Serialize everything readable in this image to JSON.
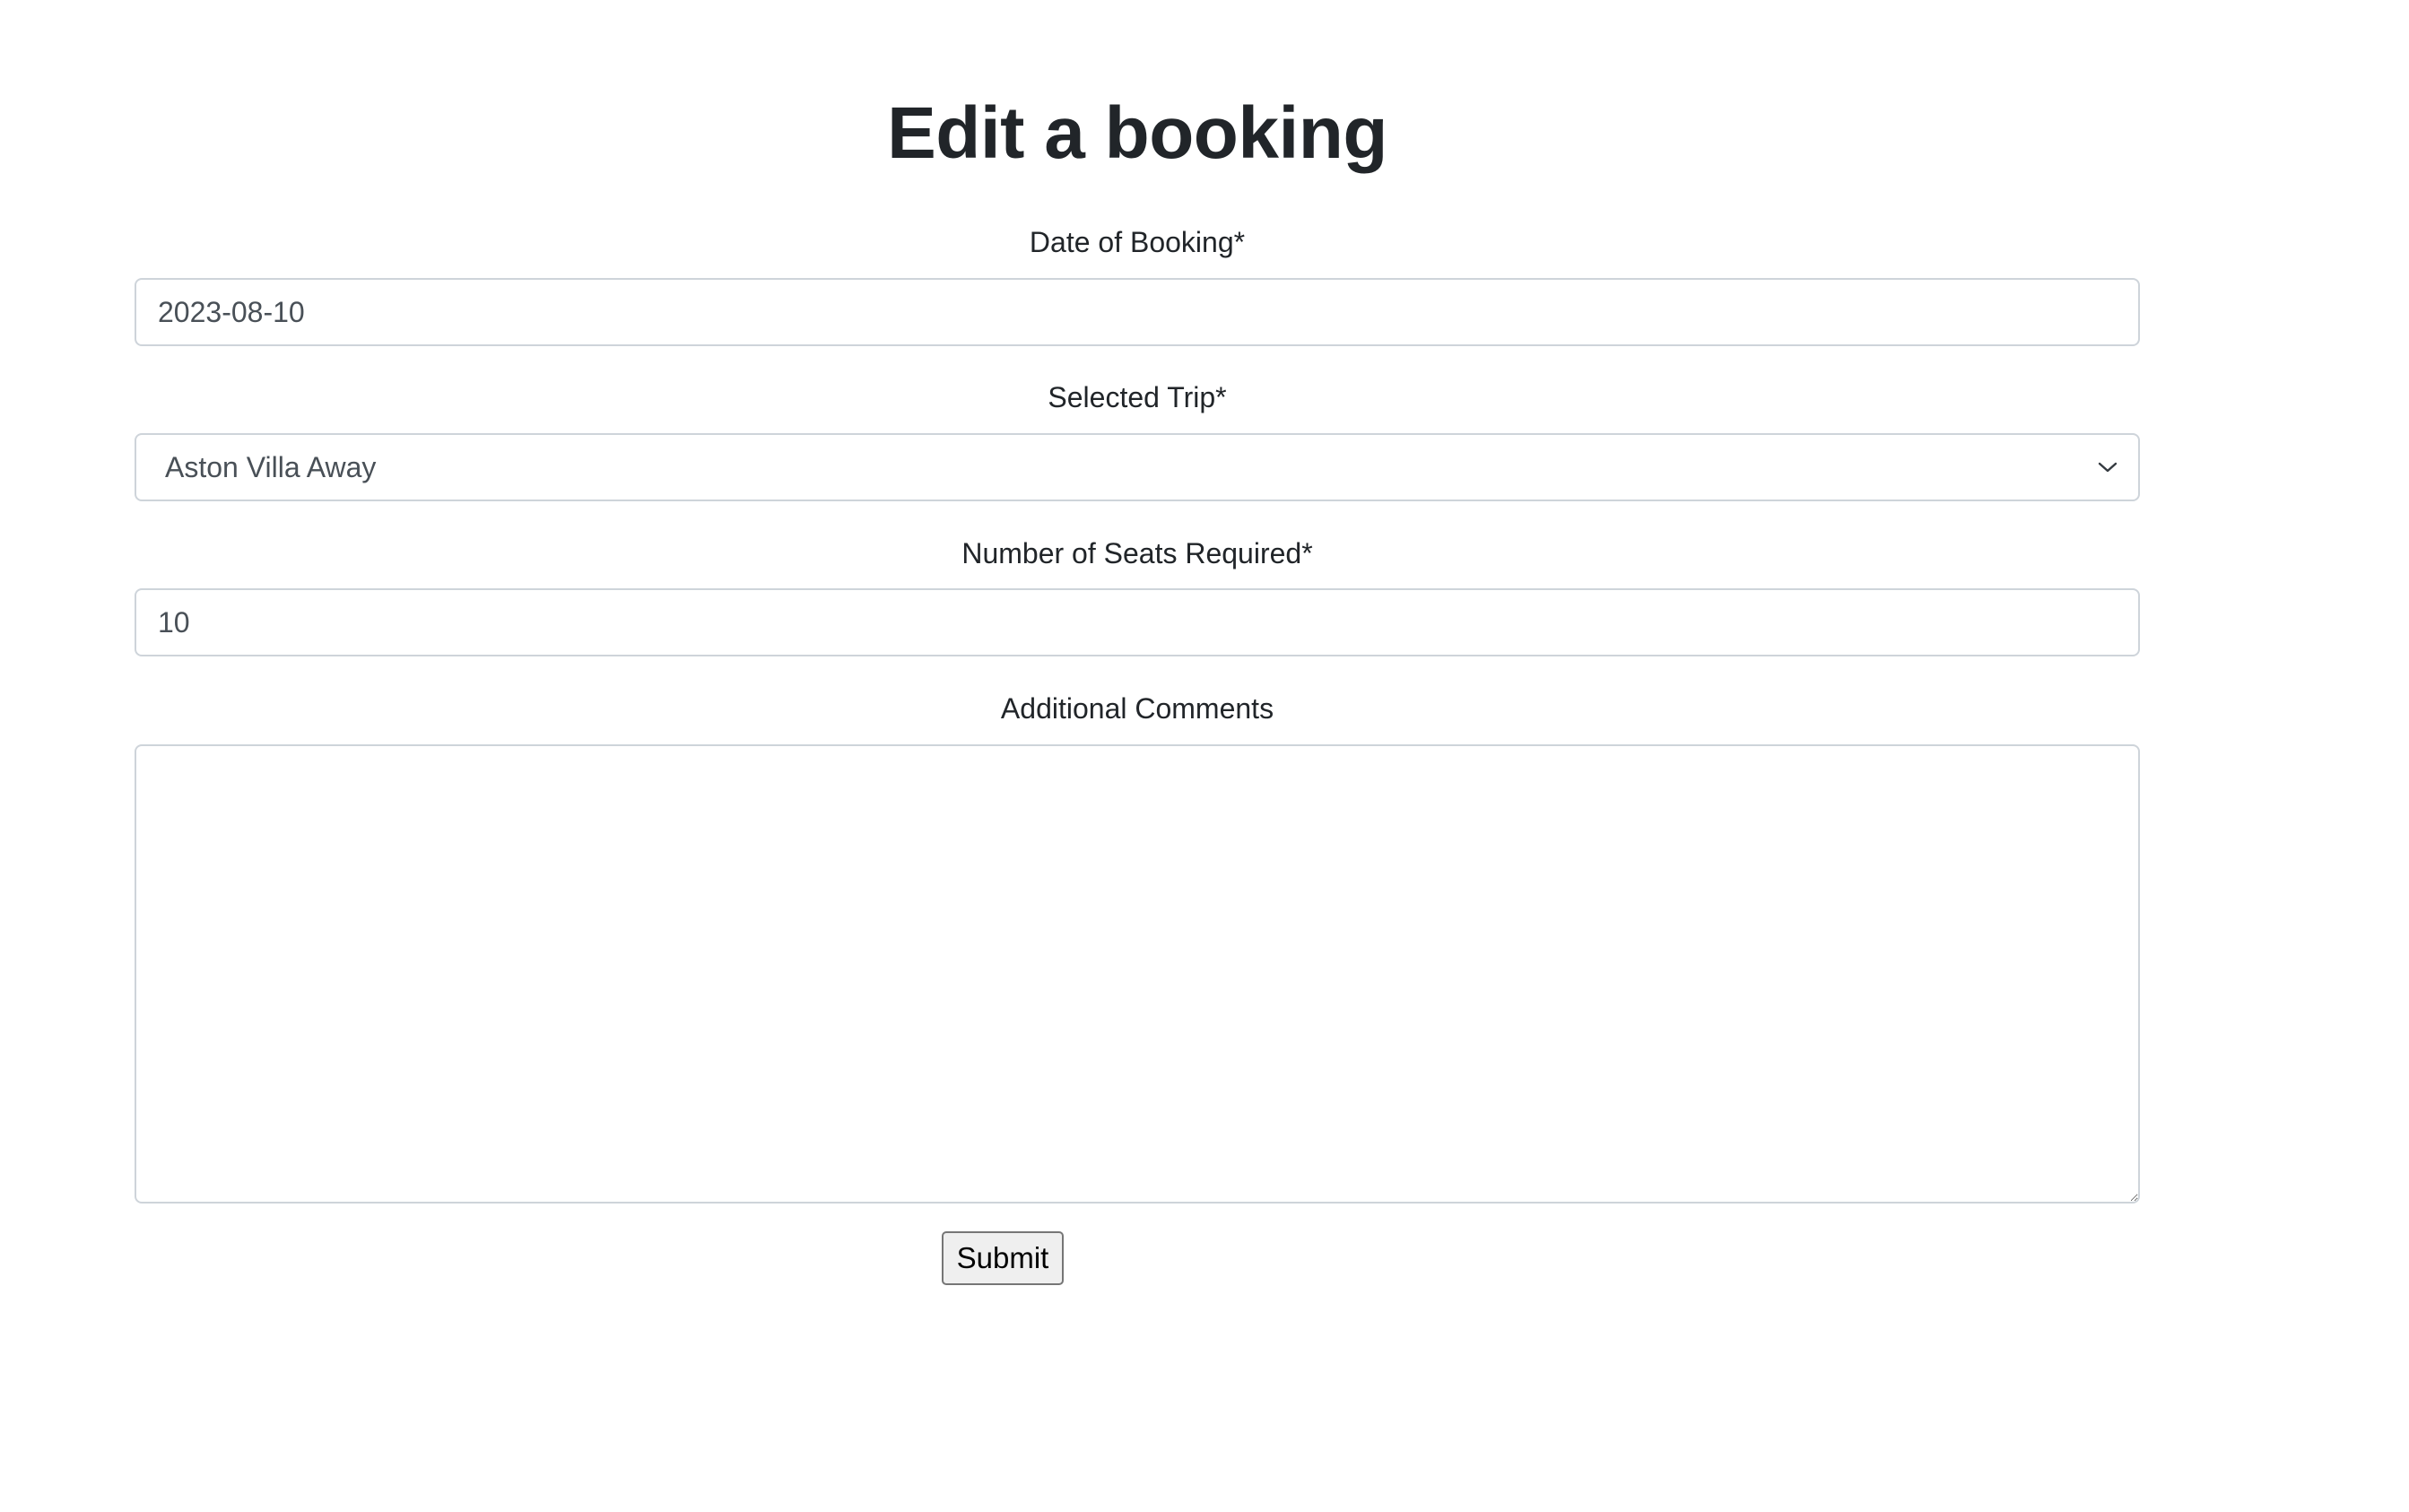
{
  "page": {
    "title": "Edit a booking"
  },
  "form": {
    "date_label": "Date of Booking*",
    "date_value": "2023-08-10",
    "trip_label": "Selected Trip*",
    "trip_selected": "Aston Villa Away",
    "seats_label": "Number of Seats Required*",
    "seats_value": "10",
    "comments_label": "Additional Comments",
    "comments_value": "",
    "submit_label": "Submit"
  },
  "icons": {
    "select_chevron": "chevron-down-icon",
    "textarea_grip": "resize-grip-icon"
  },
  "colors": {
    "text": "#212529",
    "input_text": "#495057",
    "input_border": "#ced4da",
    "button_bg": "#efefef",
    "button_border": "#767676"
  }
}
